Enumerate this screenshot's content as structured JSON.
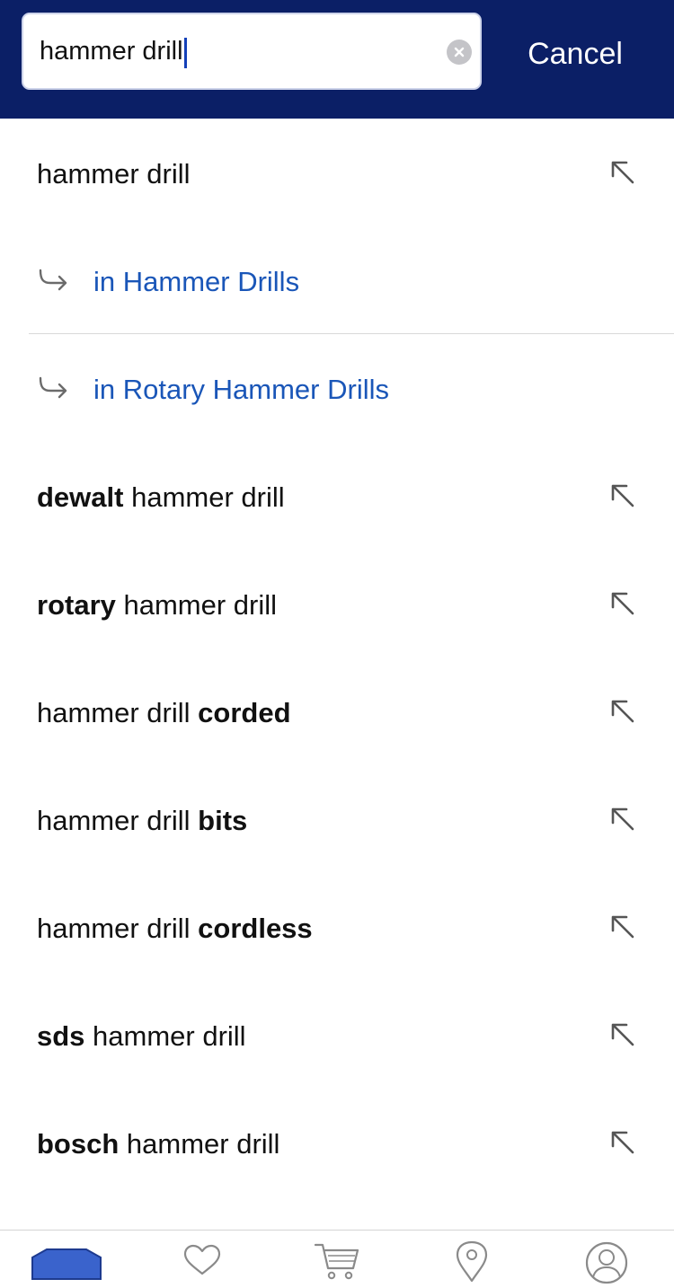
{
  "search": {
    "value": "hammer drill",
    "cancel_label": "Cancel",
    "clear_icon": "clear-circle-icon"
  },
  "suggestions": [
    {
      "type": "query",
      "prefix": "",
      "base": "hammer drill",
      "suffix": ""
    },
    {
      "type": "category",
      "label": "in Hammer Drills"
    },
    {
      "type": "category",
      "label": "in Rotary Hammer Drills"
    },
    {
      "type": "query",
      "prefix": "dewalt",
      "base": " hammer drill",
      "suffix": ""
    },
    {
      "type": "query",
      "prefix": "rotary",
      "base": " hammer drill",
      "suffix": ""
    },
    {
      "type": "query",
      "prefix": "",
      "base": "hammer drill ",
      "suffix": "corded"
    },
    {
      "type": "query",
      "prefix": "",
      "base": "hammer drill ",
      "suffix": "bits"
    },
    {
      "type": "query",
      "prefix": "",
      "base": "hammer drill ",
      "suffix": "cordless"
    },
    {
      "type": "query",
      "prefix": "sds",
      "base": " hammer drill",
      "suffix": ""
    },
    {
      "type": "query",
      "prefix": "bosch",
      "base": " hammer drill",
      "suffix": ""
    }
  ],
  "tabbar": {
    "items": [
      {
        "name": "home",
        "icon": "home-icon",
        "active": true
      },
      {
        "name": "favorites",
        "icon": "heart-icon",
        "active": false
      },
      {
        "name": "cart",
        "icon": "cart-icon",
        "active": false
      },
      {
        "name": "stores",
        "icon": "location-pin-icon",
        "active": false
      },
      {
        "name": "account",
        "icon": "account-icon",
        "active": false
      }
    ]
  },
  "colors": {
    "header_bg": "#0b1f66",
    "link": "#1a56b8",
    "active_tab": "#3a63cc"
  }
}
